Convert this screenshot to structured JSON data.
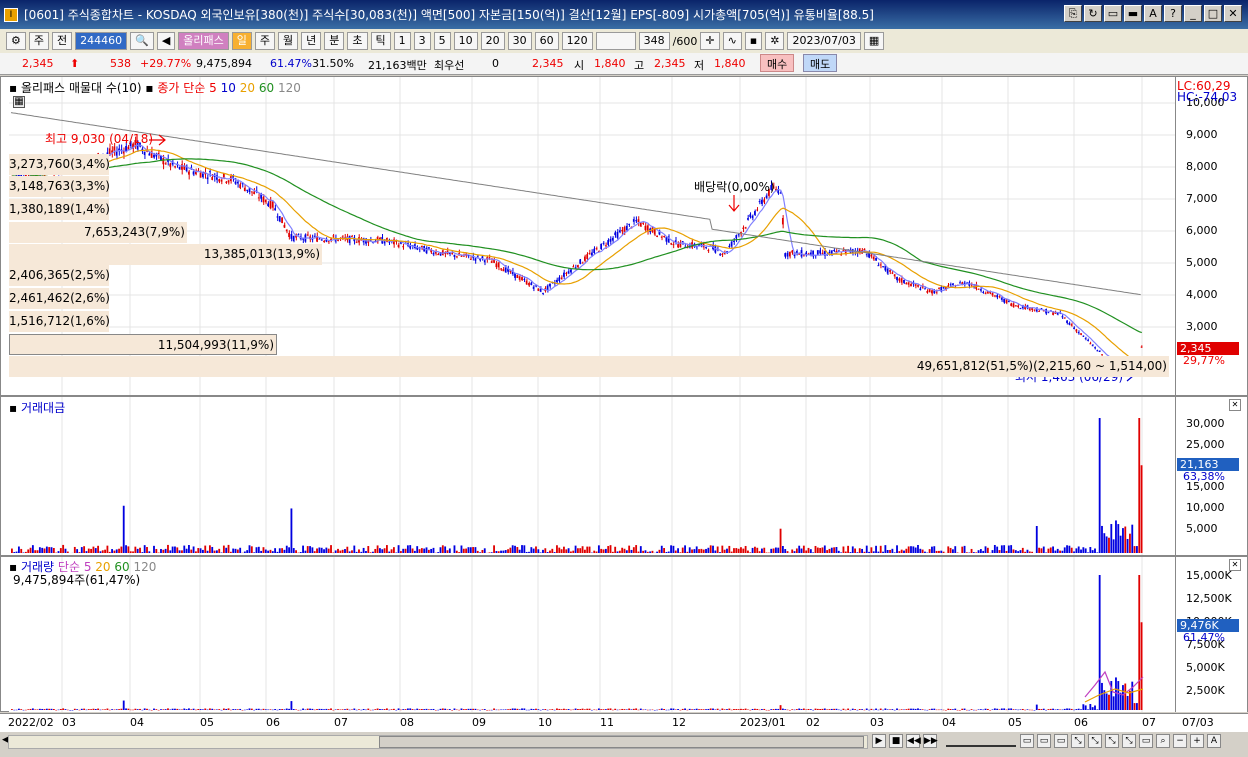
{
  "window": {
    "title": "[0601] 주식종합차트 - KOSDAQ 외국인보유[380(천)] 주식수[30,083(천)] 액면[500] 자본금[150(억)] 결산[12월] EPS[-809] 시가총액[705(억)] 유통비율[88.5]"
  },
  "toolbar": {
    "market": "주",
    "type_label": "전",
    "code": "244460",
    "name": "올리패스",
    "periods": [
      "일",
      "주",
      "월",
      "년",
      "분",
      "초",
      "틱"
    ],
    "intervals": [
      "1",
      "3",
      "5",
      "10",
      "20",
      "30",
      "60",
      "120"
    ],
    "count": "348",
    "count_max": "/600",
    "date": "2023/07/03"
  },
  "quote": {
    "price": "2,345",
    "change": "538",
    "change_pct": "+29.77%",
    "volume": "9,475,894",
    "turnover_pct": "61.47%",
    "ratio": "31.50%",
    "amount": "21,163백만",
    "priority_label": "최우선",
    "priority_val": "0",
    "ask": "2,345",
    "open_label": "시",
    "open": "1,840",
    "high_label": "고",
    "high": "2,345",
    "low_label": "저",
    "low": "1,840",
    "buy": "매수",
    "sell": "매도"
  },
  "price_panel": {
    "legend_title": "올리패스 매물대 수(10)",
    "ma_label": "종가 단순 5",
    "ma_periods": [
      "10",
      "20",
      "60",
      "120"
    ],
    "lc": "LC:60,29",
    "hc": "HC:-74,03",
    "high_ann": "최고 9,030 (04/18)",
    "low_ann": "최저 1,463 (06/29)",
    "div_ann": "배당락(0,00%)",
    "price_tag": "2,345",
    "pct_tag": "29,77%",
    "y_ticks": [
      "10,000",
      "9,000",
      "8,000",
      "7,000",
      "6,000",
      "5,000",
      "4,000",
      "3,000"
    ],
    "volume_profile": [
      {
        "label": "3,273,760(3,4%)",
        "pct": 3.4
      },
      {
        "label": "3,148,763(3,3%)",
        "pct": 3.3
      },
      {
        "label": "1,380,189(1,4%)",
        "pct": 1.4
      },
      {
        "label": "7,653,243(7,9%)",
        "pct": 7.9
      },
      {
        "label": "13,385,013(13,9%)",
        "pct": 13.9
      },
      {
        "label": "2,406,365(2,5%)",
        "pct": 2.5
      },
      {
        "label": "2,461,462(2,6%)",
        "pct": 2.6
      },
      {
        "label": "1,516,712(1,6%)",
        "pct": 1.6
      },
      {
        "label": "11,504,993(11,9%)",
        "pct": 11.9
      },
      {
        "label": "49,651,812(51,5%)(2,215,60 ~ 1,514,00)",
        "pct": 51.5
      }
    ]
  },
  "amount_panel": {
    "title": "거래대금",
    "y_ticks": [
      "30,000",
      "25,000",
      "20,000",
      "15,000",
      "10,000",
      "5,000"
    ],
    "tag": "21,163",
    "tag_pct": "63,38%"
  },
  "volume_panel": {
    "title": "거래량",
    "ma_label": "단순 5",
    "ma_periods": [
      "20",
      "60",
      "120"
    ],
    "sub": "9,475,894주(61,47%)",
    "y_ticks": [
      "15,000K",
      "12,500K",
      "10,000K",
      "7,500K",
      "5,000K",
      "2,500K"
    ],
    "tag": "9,476K",
    "tag_pct": "61,47%"
  },
  "x_axis": [
    "2022/02",
    "03",
    "04",
    "05",
    "06",
    "07",
    "08",
    "09",
    "10",
    "11",
    "12",
    "2023/01",
    "02",
    "03",
    "04",
    "05",
    "06",
    "07",
    "07/03"
  ],
  "colors": {
    "up": "#e00000",
    "down": "#0000e0",
    "ma5": "#8080ff",
    "ma20": "#e8a000",
    "ma60": "#209020",
    "ma120": "#808080"
  }
}
